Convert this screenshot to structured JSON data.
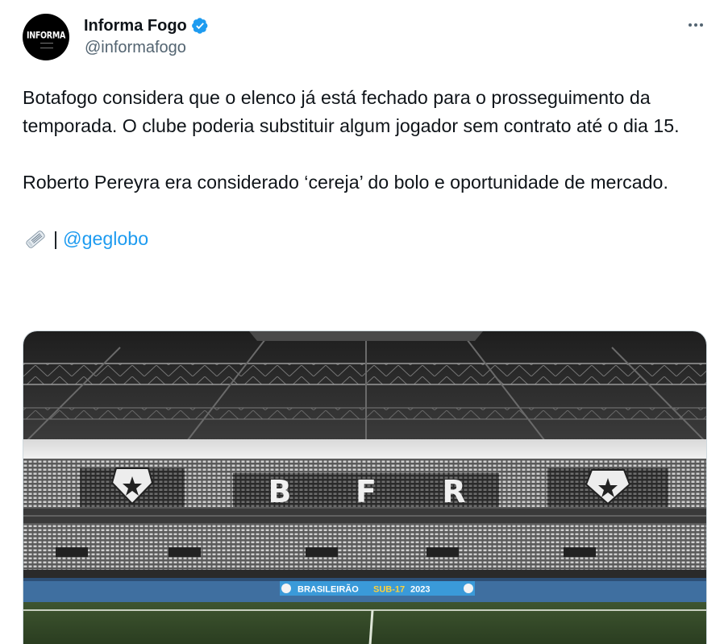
{
  "author": {
    "display_name": "Informa Fogo",
    "handle": "@informafogo",
    "avatar_text": "INFORMA",
    "verified": true,
    "verified_color": "#1d9bf0"
  },
  "menu": {
    "more_icon": "more-horizontal-icon"
  },
  "tweet": {
    "paragraphs": [
      "Botafogo considera que o elenco já está fechado para o prosseguimento da temporada. O clube poderia substituir algum jogador sem contrato até o dia 15.",
      "Roberto Pereyra era considerado ‘cereja’ do bolo e oportunidade de mercado."
    ],
    "source_icon": "newspaper-icon",
    "source_separator": "|",
    "source_mention": "@geglobo"
  },
  "media": {
    "stadium_letters": [
      "B",
      "F",
      "R"
    ],
    "banner_text_1": "BRASILEIRÃO",
    "banner_text_2": "SUB-17",
    "banner_text_3": "2023",
    "banner_color": "#3a9ad9"
  },
  "colors": {
    "text": "#0f1419",
    "secondary": "#536471",
    "link": "#1d9bf0"
  }
}
